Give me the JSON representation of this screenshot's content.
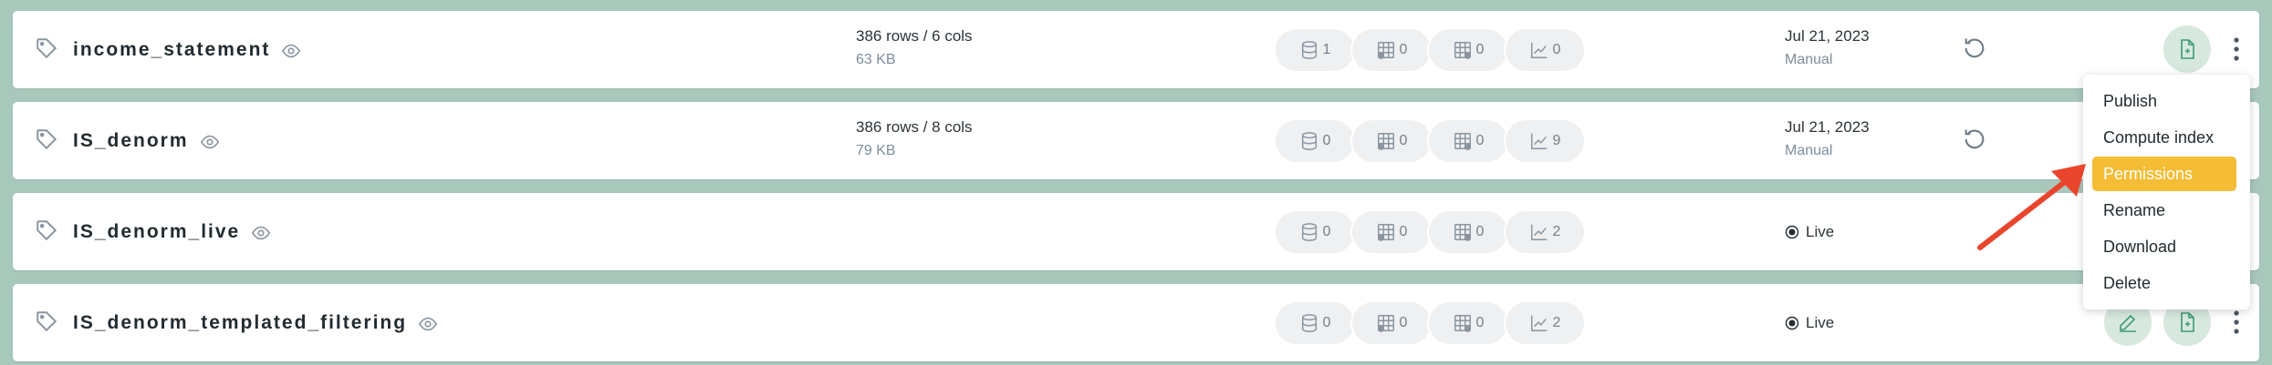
{
  "rows": [
    {
      "name": "income_statement",
      "size": "386 rows / 6 cols",
      "bytes": "63 KB",
      "counts": [
        "1",
        "0",
        "0",
        "0"
      ],
      "date": "Jul 21, 2023",
      "mode": "Manual"
    },
    {
      "name": "IS_denorm",
      "size": "386 rows / 8 cols",
      "bytes": "79 KB",
      "counts": [
        "0",
        "0",
        "0",
        "9"
      ],
      "date": "Jul 21, 2023",
      "mode": "Manual"
    },
    {
      "name": "IS_denorm_live",
      "counts": [
        "0",
        "0",
        "0",
        "2"
      ],
      "status": "Live"
    },
    {
      "name": "IS_denorm_templated_filtering",
      "counts": [
        "0",
        "0",
        "0",
        "2"
      ],
      "status": "Live"
    }
  ],
  "menu": {
    "items": [
      "Publish",
      "Compute index",
      "Permissions",
      "Rename",
      "Download",
      "Delete"
    ],
    "highlighted": "Permissions"
  },
  "colors": {
    "background": "#a9c8bc",
    "highlight": "#f4bd35",
    "arrow": "#e8452c",
    "action_button": "#d7e8df"
  },
  "icons": [
    "tag-icon",
    "eye-icon",
    "database-icon",
    "table-icon",
    "view-icon",
    "chart-icon",
    "refresh-icon",
    "live-radio-icon",
    "edit-icon",
    "file-icon",
    "kebab-icon"
  ]
}
